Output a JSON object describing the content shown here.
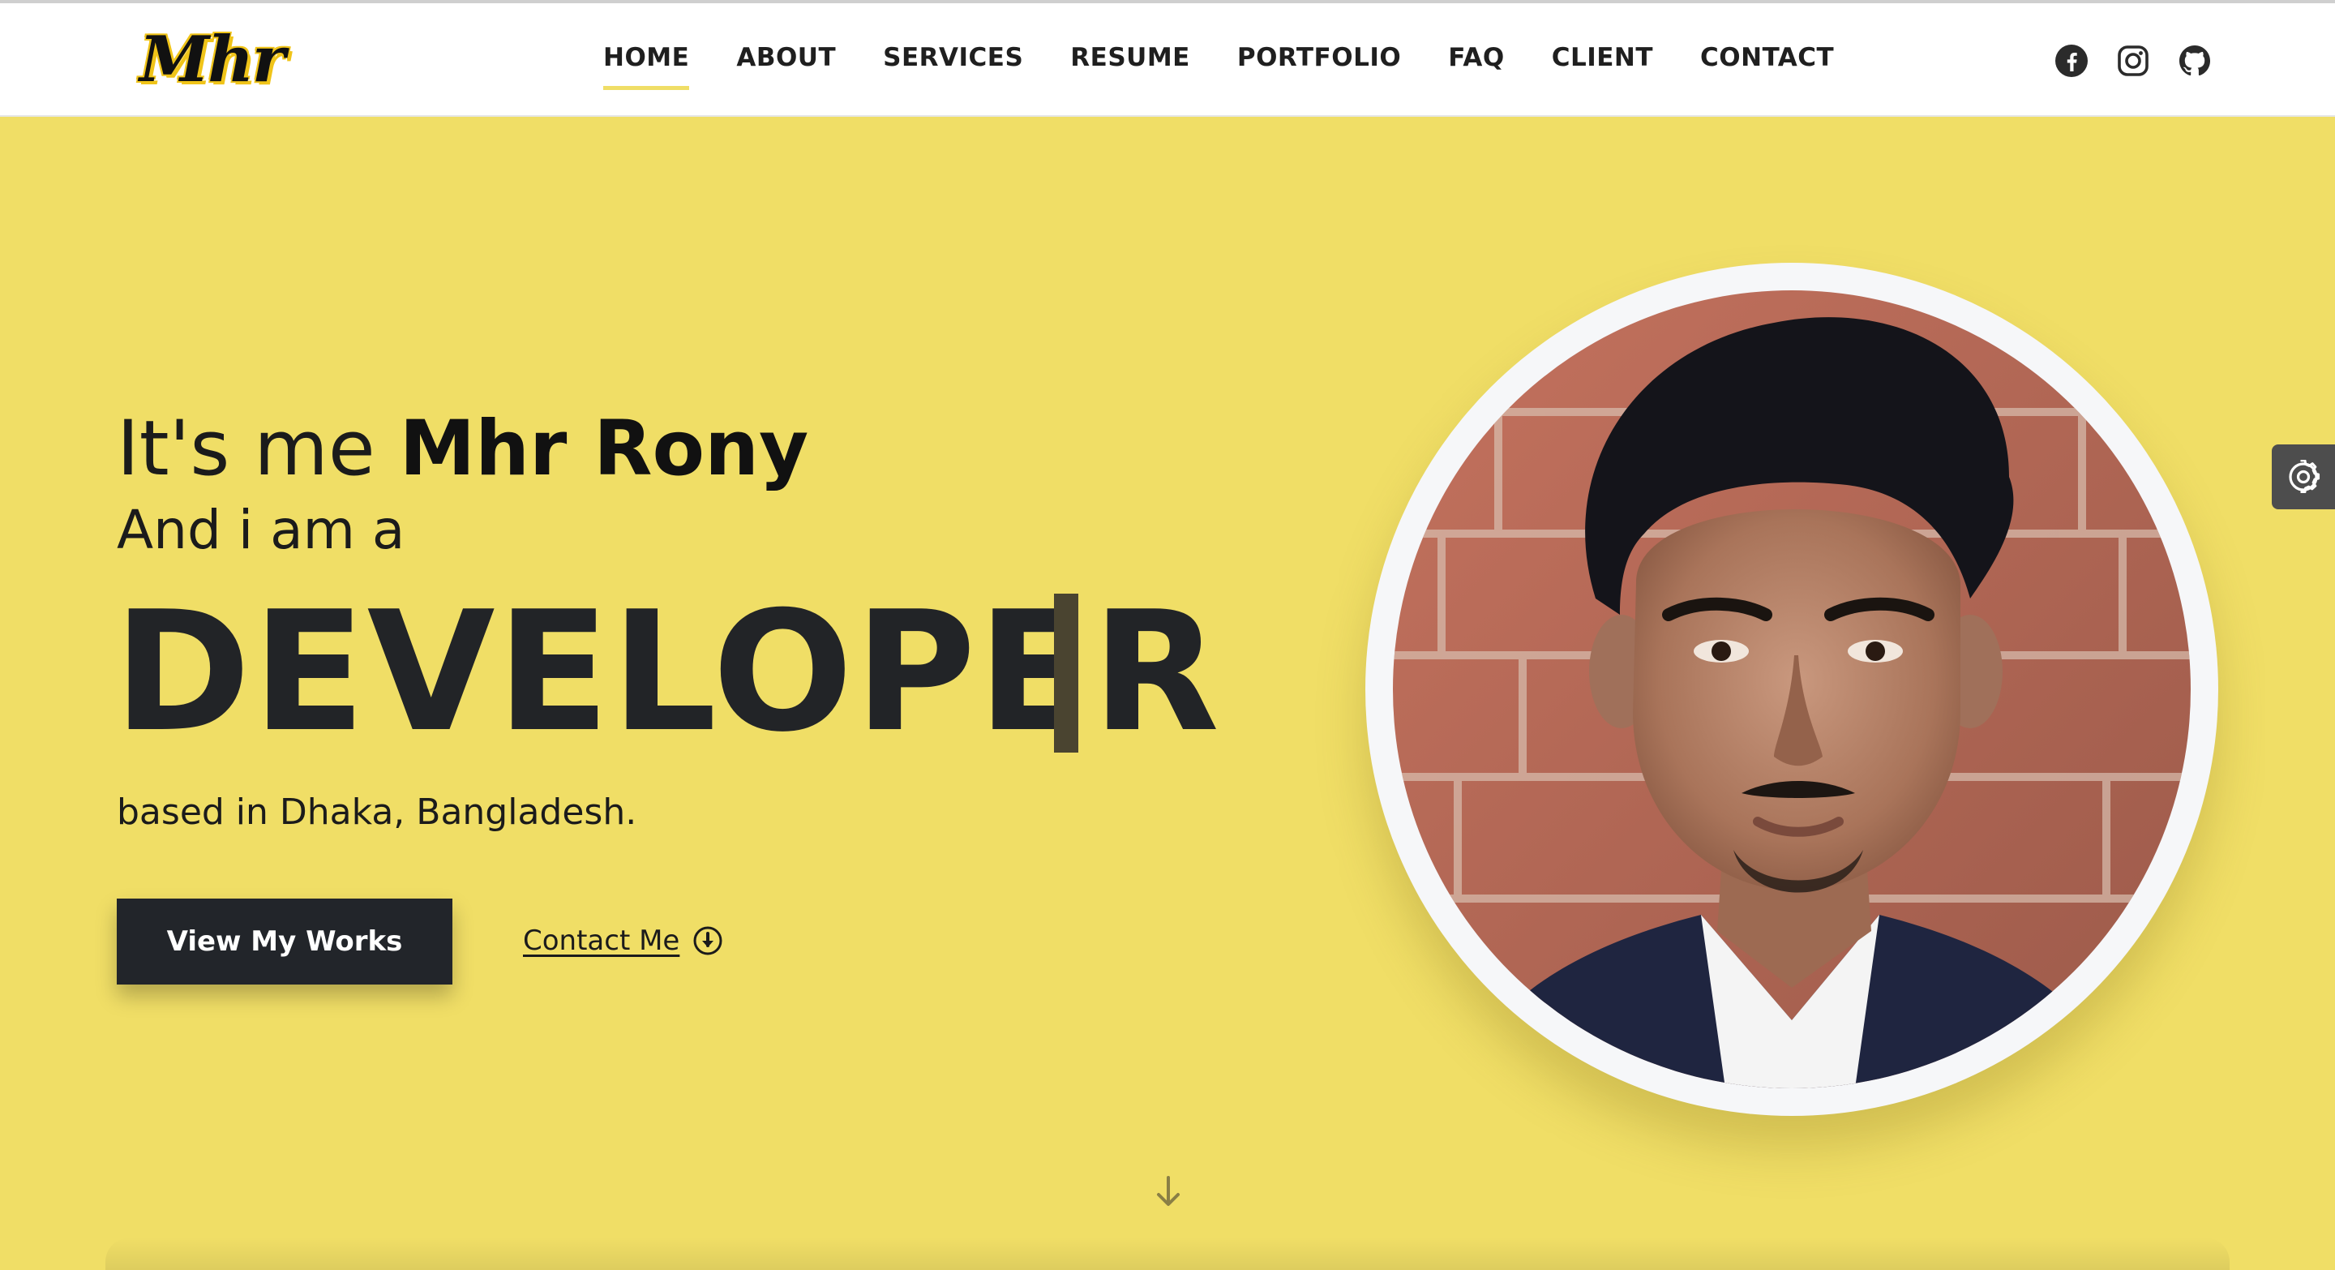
{
  "brand": {
    "logo_text": "Mhr"
  },
  "nav": {
    "items": [
      {
        "label": "HOME",
        "active": true
      },
      {
        "label": "ABOUT",
        "active": false
      },
      {
        "label": "SERVICES",
        "active": false
      },
      {
        "label": "RESUME",
        "active": false
      },
      {
        "label": "PORTFOLIO",
        "active": false
      },
      {
        "label": "FAQ",
        "active": false
      },
      {
        "label": "CLIENT",
        "active": false
      },
      {
        "label": "CONTACT",
        "active": false
      }
    ]
  },
  "social": {
    "icons": [
      "facebook-icon",
      "instagram-icon",
      "github-icon"
    ]
  },
  "hero": {
    "intro_prefix": "It's me ",
    "name": "Mhr Rony",
    "subline": "And i am a",
    "role": "DEVELOPER",
    "location": "based in Dhaka, Bangladesh.",
    "primary_button": "View My Works",
    "secondary_link": "Contact Me"
  },
  "colors": {
    "hero_background": "#f0de66",
    "header_background": "#ffffff",
    "accent_underline": "#f0de66",
    "button_dark": "#22252a"
  }
}
